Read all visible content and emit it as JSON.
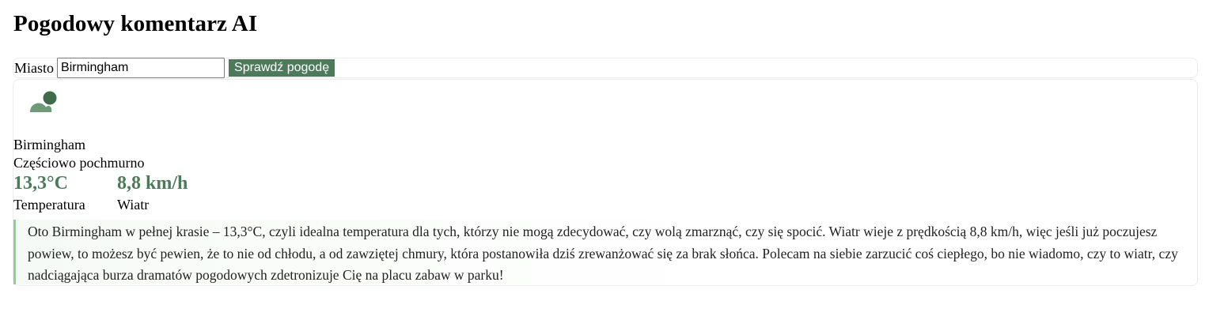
{
  "app": {
    "title": "Pogodowy komentarz AI"
  },
  "search": {
    "label": "Miasto",
    "value": "Birmingham",
    "button_label": "Sprawdź pogodę"
  },
  "weather": {
    "icon": "partly-cloudy-icon",
    "city": "Birmingham",
    "condition": "Częściowo pochmurno",
    "temperature": {
      "value": "13,3°C",
      "caption": "Temperatura"
    },
    "wind": {
      "value": "8,8 km/h",
      "caption": "Wiatr"
    }
  },
  "commentary": "Oto Birmingham w pełnej krasie – 13,3°C, czyli idealna temperatura dla tych, którzy nie mogą zdecydować, czy wolą zmarznąć, czy się spocić. Wiatr wieje z prędkością 8,8 km/h, więc jeśli już poczujesz powiew, to możesz być pewien, że to nie od chłodu, a od zawziętej chmury, która postanowiła dziś zrewanżować się za brak słońca. Polecam na siebie zarzucić coś ciepłego, bo nie wiadomo, czy to wiatr, czy nadciągająca burza dramatów pogodowych zdetronizuje Cię na placu zabaw w parku!",
  "colors": {
    "accent": "#4d7a5a",
    "icon_light": "#6e9a78",
    "icon_dark": "#3f6b4c",
    "comment_border": "#88d38e"
  }
}
